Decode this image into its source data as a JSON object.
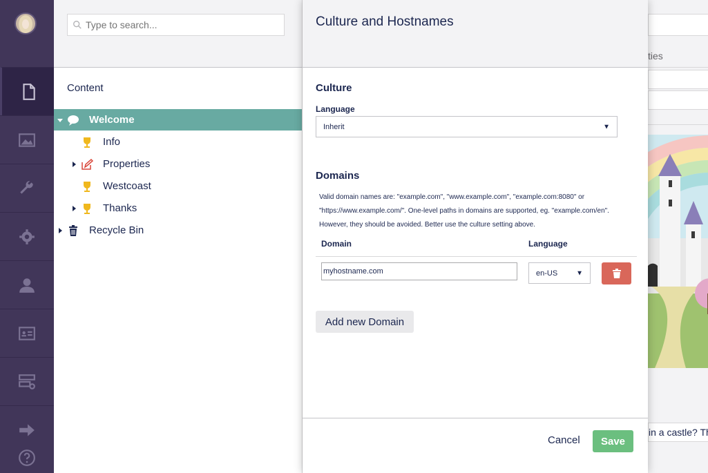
{
  "tree": {
    "search_placeholder": "Type to search...",
    "section_title": "Content",
    "items": [
      {
        "label": "Welcome",
        "icon": "speech-bubble-icon",
        "selected": true
      },
      {
        "label": "Info",
        "icon": "trophy-icon"
      },
      {
        "label": "Properties",
        "icon": "edit-icon"
      },
      {
        "label": "Westcoast",
        "icon": "trophy-icon"
      },
      {
        "label": "Thanks",
        "icon": "trophy-icon"
      },
      {
        "label": "Recycle Bin",
        "icon": "trash-icon"
      }
    ]
  },
  "appnav": {
    "items": [
      "document-icon",
      "media-icon",
      "wrench-icon",
      "gear-icon",
      "user-icon",
      "id-card-icon",
      "form-icon"
    ],
    "bottom": [
      "arrow-right-icon",
      "help-icon"
    ]
  },
  "dialog": {
    "title": "Culture and Hostnames",
    "culture": {
      "section_title": "Culture",
      "language_label": "Language",
      "language_value": "Inherit"
    },
    "domains": {
      "section_title": "Domains",
      "help_text": "Valid domain names are: \"example.com\", \"www.example.com\", \"example.com:8080\" or \"https://www.example.com/\". One-level paths in domains are supported, eg. \"example.com/en\". However, they should be avoided. Better use the culture setting above.",
      "col_domain": "Domain",
      "col_language": "Language",
      "rows": [
        {
          "domain": "myhostname.com",
          "language": "en-US"
        }
      ],
      "add_button": "Add new Domain"
    },
    "footer": {
      "cancel_label": "Cancel",
      "save_label": "Save"
    }
  },
  "background_editor": {
    "tab_fragment": "ties",
    "question_fragment": "in a castle? Th"
  },
  "colors": {
    "nav_bg": "#413659",
    "selected_row": "#68aaa2",
    "save_green": "#6bbf7f",
    "delete_red": "#d9675a",
    "text": "#1b264f"
  }
}
